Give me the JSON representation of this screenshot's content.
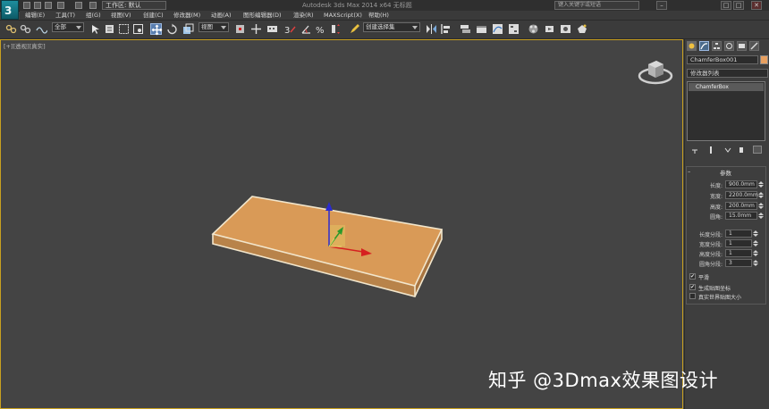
{
  "window": {
    "title": "Autodesk 3ds Max  2014 x64    无标题",
    "workspace_label": "工作区: 默认",
    "search_placeholder": "键入关键字或短语",
    "min_glyph": "–",
    "max_glyph": "□",
    "close_glyph": "✕"
  },
  "menu": [
    {
      "label": "编辑(E)"
    },
    {
      "label": "工具(T)"
    },
    {
      "label": "组(G)"
    },
    {
      "label": "视图(V)"
    },
    {
      "label": "创建(C)"
    },
    {
      "label": "修改器(M)"
    },
    {
      "label": "动画(A)"
    },
    {
      "label": "图形编辑器(D)"
    },
    {
      "label": "渲染(R)"
    },
    {
      "label": "MAXScript(X)"
    },
    {
      "label": "帮助(H)"
    }
  ],
  "toolbar": {
    "selection_filter": "全部",
    "ref_coord": "视图",
    "selection_set": "创建选择集"
  },
  "viewport": {
    "label": "[+][透视][真实]"
  },
  "command_panel": {
    "object_name": "ChamferBox001",
    "modifier_list": "修改器列表",
    "stack_item": "ChamferBox",
    "params_title": "参数",
    "params": [
      {
        "label": "长度:",
        "value": "900.0mm"
      },
      {
        "label": "宽度:",
        "value": "2200.0mm"
      },
      {
        "label": "高度:",
        "value": "200.0mm"
      },
      {
        "label": "圆角:",
        "value": "15.0mm"
      }
    ],
    "segments": [
      {
        "label": "长度分段:",
        "value": "1"
      },
      {
        "label": "宽度分段:",
        "value": "1"
      },
      {
        "label": "高度分段:",
        "value": "1"
      },
      {
        "label": "圆角分段:",
        "value": "3"
      }
    ],
    "checkboxes": [
      {
        "label": "平滑",
        "checked": "✔"
      },
      {
        "label": "生成贴图坐标",
        "checked": "✔"
      },
      {
        "label": "真实世界贴图大小",
        "checked": ""
      }
    ]
  },
  "watermark": "知乎 @3Dmax效果图设计",
  "colors": {
    "box_face": "#e0a05a",
    "box_edge": "#f2e6cc",
    "viewport_bg": "#444444",
    "gizmo_x": "#d62020",
    "gizmo_y": "#2a9a2a",
    "gizmo_z": "#2a2ad0",
    "object_color_swatch": "#e8a060"
  }
}
